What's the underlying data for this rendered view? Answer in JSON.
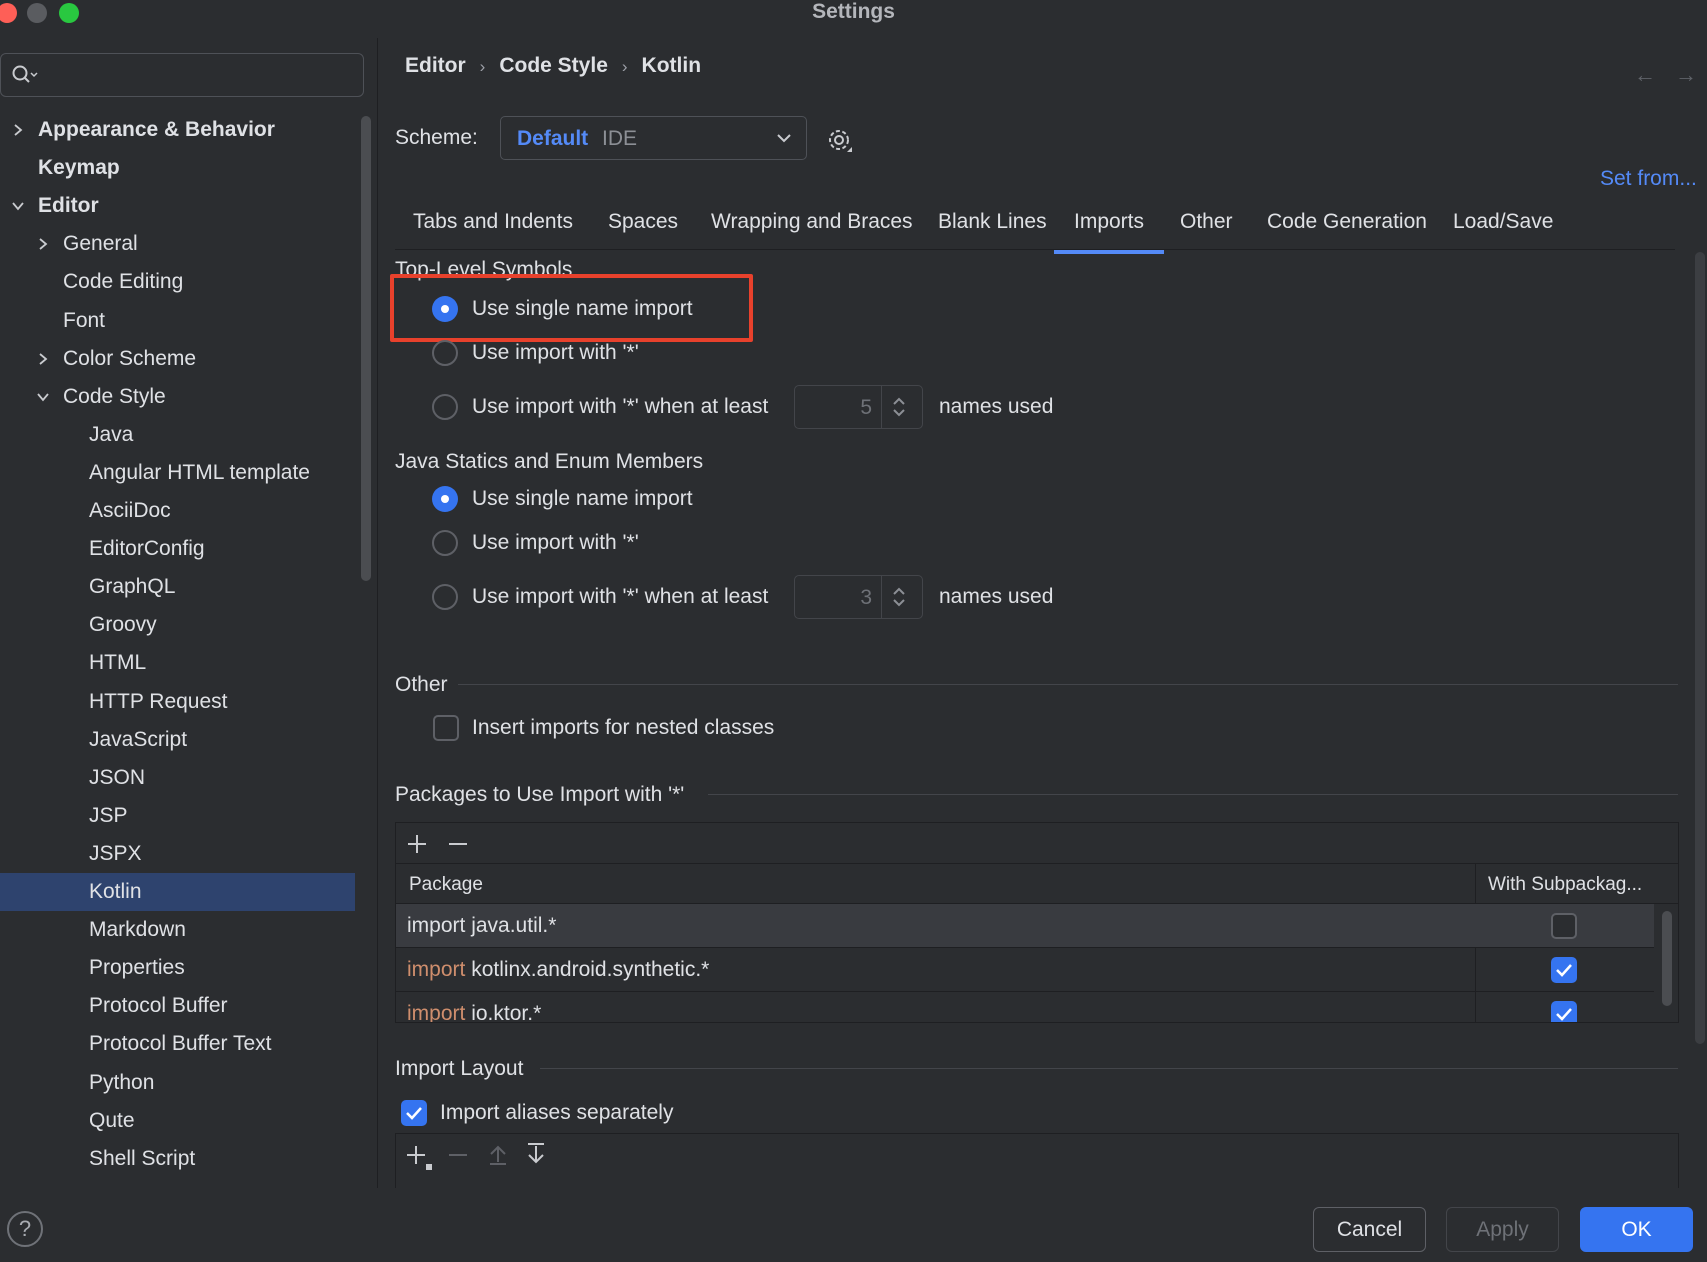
{
  "window": {
    "title": "Settings"
  },
  "sidebar": {
    "search_placeholder": "",
    "tree": [
      {
        "label": "Appearance & Behavior",
        "bold": true,
        "chevron": "right"
      },
      {
        "label": "Keymap",
        "bold": true
      },
      {
        "label": "Editor",
        "bold": true,
        "chevron": "down"
      },
      {
        "label": "General",
        "chevron": "right"
      },
      {
        "label": "Code Editing"
      },
      {
        "label": "Font"
      },
      {
        "label": "Color Scheme",
        "chevron": "right"
      },
      {
        "label": "Code Style",
        "chevron": "down"
      },
      {
        "label": "Java"
      },
      {
        "label": "Angular HTML template"
      },
      {
        "label": "AsciiDoc"
      },
      {
        "label": "EditorConfig"
      },
      {
        "label": "GraphQL"
      },
      {
        "label": "Groovy"
      },
      {
        "label": "HTML"
      },
      {
        "label": "HTTP Request"
      },
      {
        "label": "JavaScript"
      },
      {
        "label": "JSON"
      },
      {
        "label": "JSP"
      },
      {
        "label": "JSPX"
      },
      {
        "label": "Kotlin",
        "selected": true
      },
      {
        "label": "Markdown"
      },
      {
        "label": "Properties"
      },
      {
        "label": "Protocol Buffer"
      },
      {
        "label": "Protocol Buffer Text"
      },
      {
        "label": "Python"
      },
      {
        "label": "Qute"
      },
      {
        "label": "Shell Script"
      }
    ]
  },
  "breadcrumb": [
    "Editor",
    "Code Style",
    "Kotlin"
  ],
  "scheme": {
    "label": "Scheme:",
    "name": "Default",
    "kind": "IDE"
  },
  "set_from": "Set from...",
  "tabs": [
    "Tabs and Indents",
    "Spaces",
    "Wrapping and Braces",
    "Blank Lines",
    "Imports",
    "Other",
    "Code Generation",
    "Load/Save"
  ],
  "active_tab": "Imports",
  "top_level": {
    "title": "Top-Level Symbols",
    "opt_single": "Use single name import",
    "opt_star": "Use import with '*'",
    "opt_star_atleast": "Use import with '*' when at least",
    "count": "5",
    "names_used": "names used",
    "selected": "single"
  },
  "java_statics": {
    "title": "Java Statics and Enum Members",
    "opt_single": "Use single name import",
    "opt_star": "Use import with '*'",
    "opt_star_atleast": "Use import with '*' when at least",
    "count": "3",
    "names_used": "names used",
    "selected": "single"
  },
  "other": {
    "title": "Other",
    "nested_label": "Insert imports for nested classes",
    "nested_checked": false
  },
  "packages": {
    "title": "Packages to Use Import with '*'",
    "col_package": "Package",
    "col_sub": "With Subpackag...",
    "rows": [
      {
        "keyword": "import",
        "name": "java.util.*",
        "subpackages": false,
        "selected": true
      },
      {
        "keyword": "import",
        "name": "kotlinx.android.synthetic.*",
        "subpackages": true
      },
      {
        "keyword": "import",
        "name": "io.ktor.*",
        "subpackages": true
      }
    ]
  },
  "import_layout": {
    "title": "Import Layout",
    "aliases_label": "Import aliases separately",
    "aliases_checked": true
  },
  "footer": {
    "help": "?",
    "cancel": "Cancel",
    "apply": "Apply",
    "ok": "OK"
  },
  "colors": {
    "accent": "#3574f0",
    "link": "#548af7",
    "keyword": "#cf8e6d",
    "highlight_box": "#e8412c"
  }
}
